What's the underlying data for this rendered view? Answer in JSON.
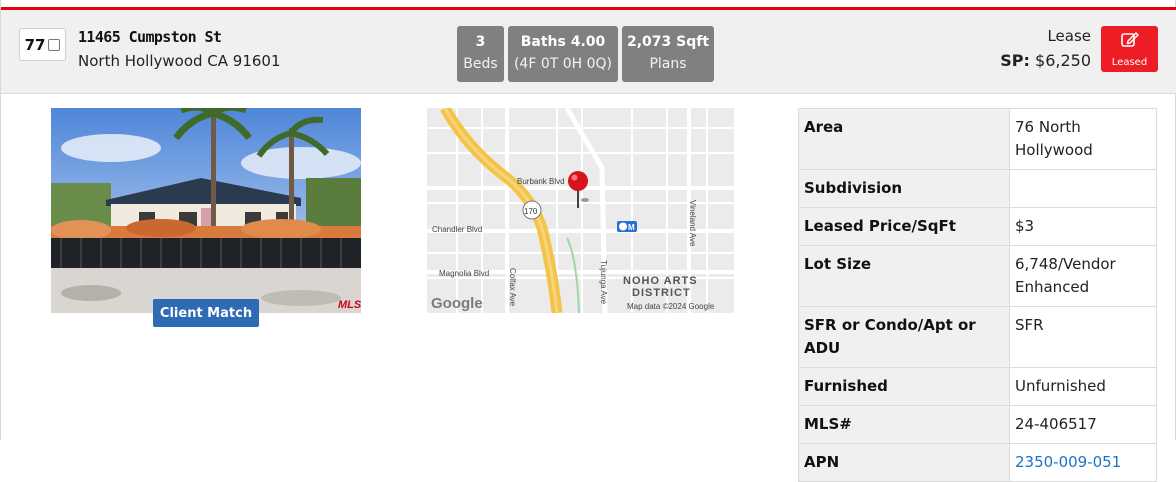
{
  "listing": {
    "index": "77",
    "street": "11465 Cumpston St",
    "city_line": "North Hollywood CA 91601",
    "stats": [
      {
        "top": "3",
        "bottom": "Beds"
      },
      {
        "top": "Baths 4.00",
        "bottom": "(4F 0T 0H 0Q)"
      },
      {
        "top": "2,073 Sqft",
        "bottom": "Plans"
      }
    ],
    "status": "Lease",
    "sp_label": "SP:",
    "sp_value": "$6,250",
    "leased_button": "Leased",
    "client_match": "Client Match",
    "photo_watermark": "MLS"
  },
  "map": {
    "labels": {
      "burbank": "Burbank Blvd",
      "chandler": "Chandler Blvd",
      "magnolia": "Magnolia Blvd",
      "colfax": "Colfax Ave",
      "tujunga": "Tujunga Ave",
      "vineland": "Vineland Ave",
      "noho1": "NOHO ARTS",
      "noho2": "DISTRICT",
      "hwy": "170",
      "google": "Google",
      "attribution": "Map data ©2024 Google"
    }
  },
  "details": [
    {
      "key": "Area",
      "value": "76 North Hollywood",
      "link": false
    },
    {
      "key": "Subdivision",
      "value": "",
      "link": false
    },
    {
      "key": "Leased Price/SqFt",
      "value": "$3",
      "link": false
    },
    {
      "key": "Lot Size",
      "value": "6,748/Vendor Enhanced",
      "link": false
    },
    {
      "key": "SFR or Condo/Apt or ADU",
      "value": "SFR",
      "link": false
    },
    {
      "key": "Furnished",
      "value": "Unfurnished",
      "link": false
    },
    {
      "key": "MLS#",
      "value": "24-406517",
      "link": false
    },
    {
      "key": "APN",
      "value": "2350-009-051",
      "link": true
    }
  ],
  "colors": {
    "accent_red": "#ee1c24",
    "stat_gray": "#808080",
    "button_blue": "#2e6bb5",
    "link_blue": "#1a73c8"
  },
  "icons": {
    "leased_button": "edit-icon",
    "map_pin": "map-pin-icon",
    "transit": "metro-icon"
  }
}
